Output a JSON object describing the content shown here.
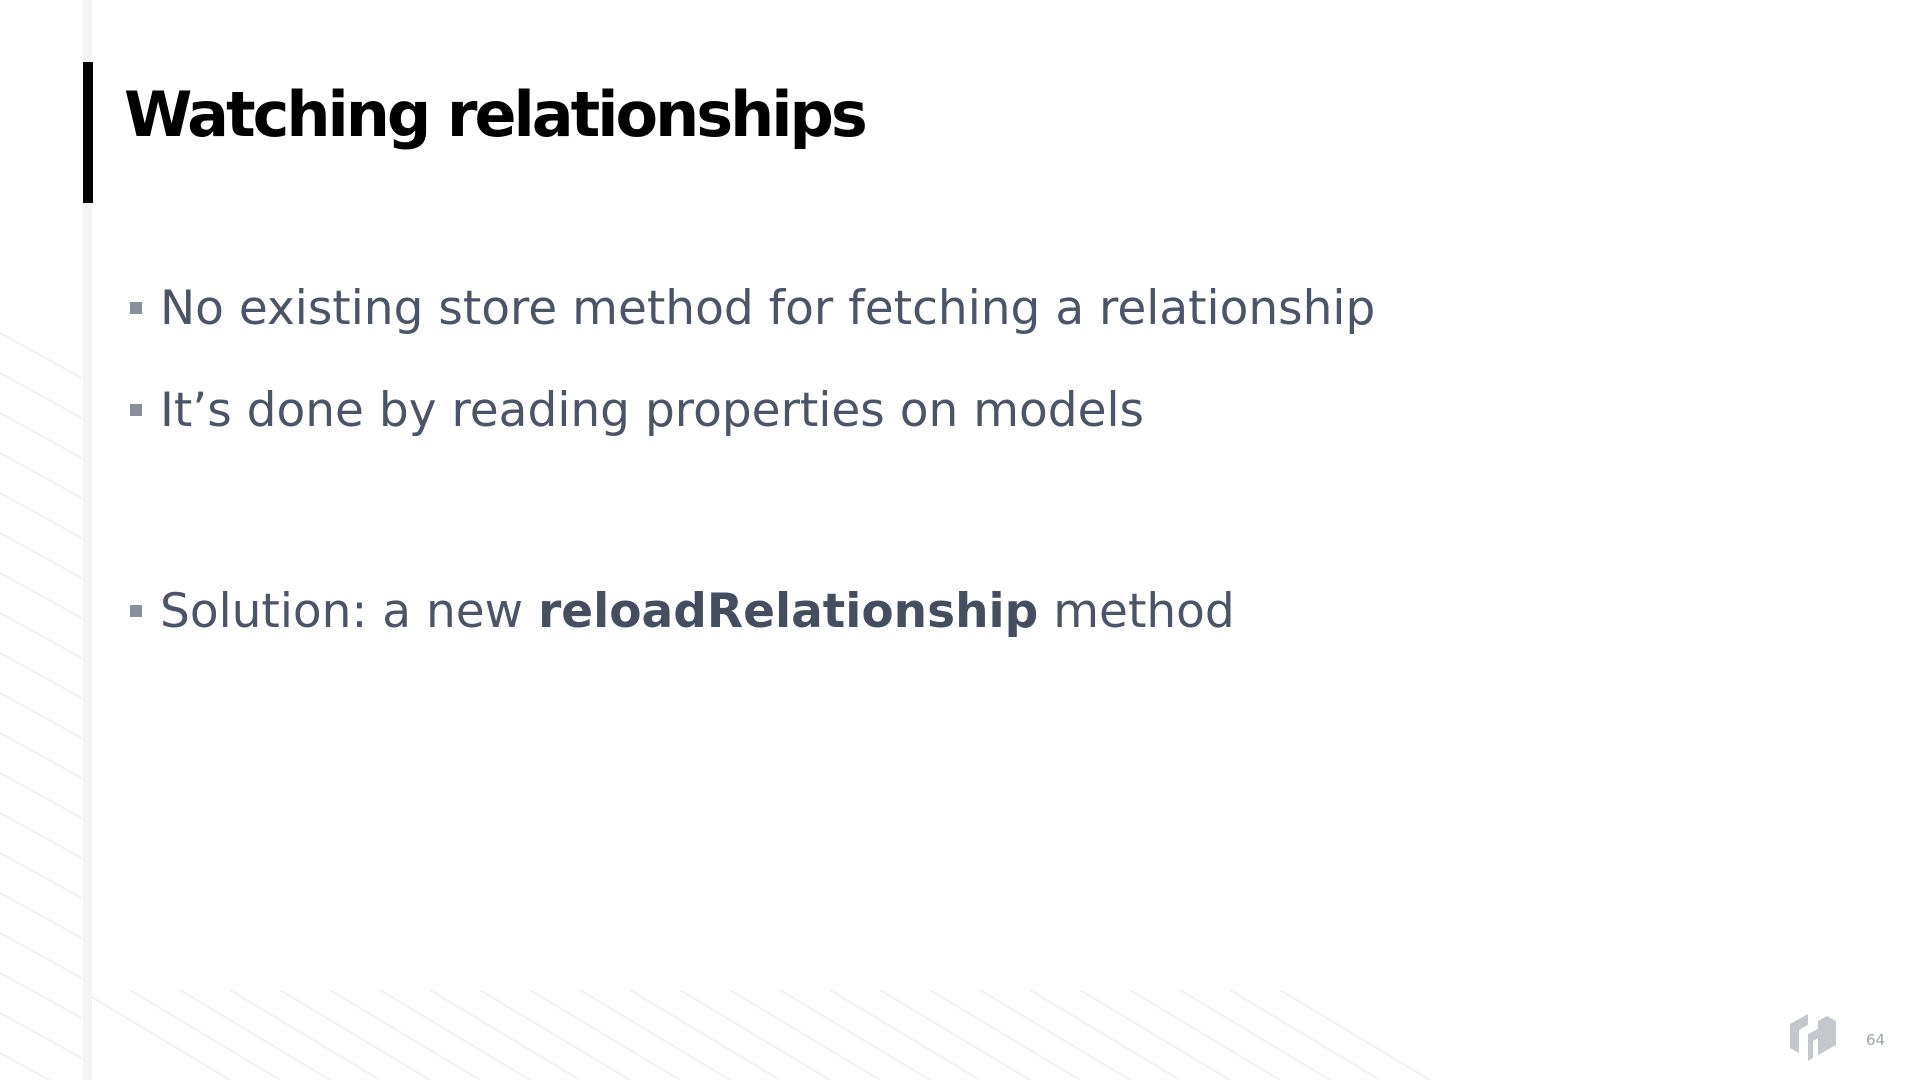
{
  "slide": {
    "title": "Watching relationships",
    "bullets": [
      {
        "text": "No existing store method for fetching a relationship"
      },
      {
        "text": "It’s done by reading properties on models"
      },
      {
        "prefix": "Solution: a new ",
        "bold": "reloadRelationship",
        "suffix": " method"
      }
    ],
    "page_number": "64"
  },
  "icons": {
    "logo": "hashicorp-logo-icon",
    "bullet": "square-bullet-icon"
  },
  "colors": {
    "title": "#000000",
    "body_text": "#4b5567",
    "accent_bar": "#000000",
    "bullet_marker": "#8a9099",
    "logo": "#c4c7cb",
    "background_pattern": "#f2f2f2"
  }
}
